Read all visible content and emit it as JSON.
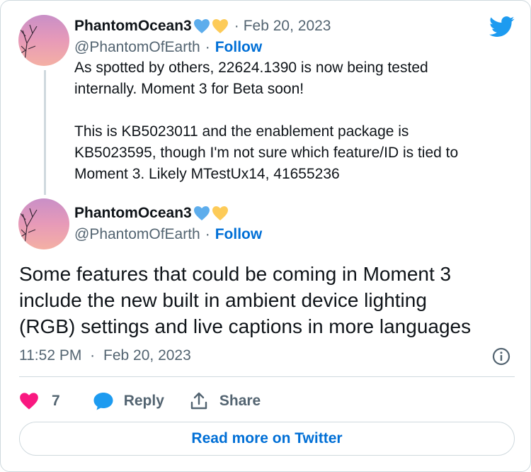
{
  "first_tweet": {
    "author_name": "PhantomOcean3",
    "author_handle": "@PhantomOfEarth",
    "date": "Feb 20, 2023",
    "separator": "·",
    "follow_label": "Follow",
    "text_lines": [
      "As spotted by others, 22624.1390 is now being tested",
      "internally. Moment 3 for Beta soon!",
      "This is KB5023011 and the enablement package is",
      "KB5023595, though I'm not sure which feature/ID is tied to",
      "Moment 3. Likely MTestUx14, 41655236"
    ]
  },
  "main_tweet": {
    "author_name": "PhantomOcean3",
    "author_handle": "@PhantomOfEarth",
    "separator": "·",
    "follow_label": "Follow",
    "text_lines": [
      "Some features that could be coming in Moment 3",
      "include the new built in ambient device lighting",
      "(RGB) settings and live captions in more languages"
    ],
    "time": "11:52 PM",
    "date": "Feb 20, 2023",
    "like_count": "7",
    "reply_label": "Reply",
    "share_label": "Share"
  },
  "read_more_label": "Read more on Twitter",
  "colors": {
    "twitter_blue": "#1d9bf0",
    "link_blue": "#006fd6",
    "like_pink": "#f91880",
    "secondary_text": "#536471",
    "border": "#cfd9de",
    "emoji_blue_heart": "#5dadec",
    "emoji_yellow_heart": "#fdcb58"
  },
  "icons": [
    "twitter-logo-icon",
    "blue-heart-emoji-icon",
    "yellow-heart-emoji-icon",
    "heart-icon",
    "reply-bubble-icon",
    "share-icon",
    "info-icon"
  ]
}
